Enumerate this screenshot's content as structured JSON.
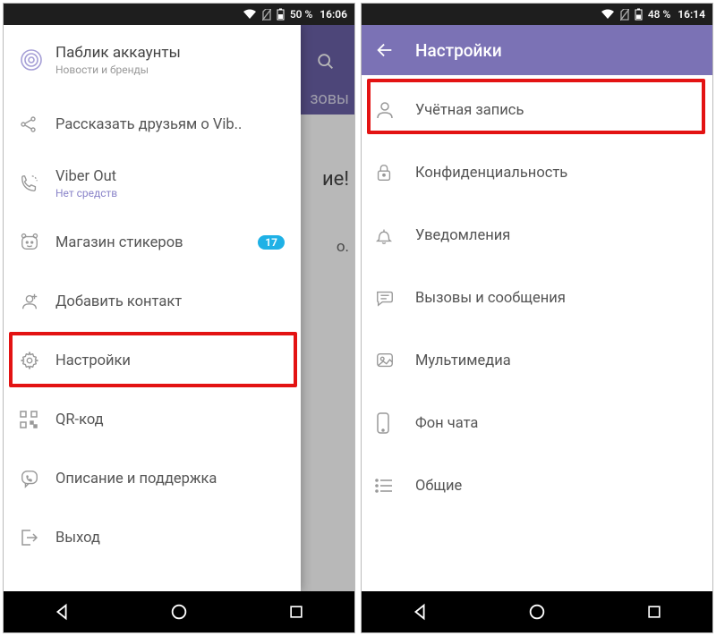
{
  "left": {
    "status": {
      "battery_pct": "50 %",
      "time": "16:06"
    },
    "bg": {
      "tabtail": "зовы",
      "linetail": "ие!",
      "dot": "о."
    },
    "drawer": {
      "header": {
        "title": "Паблик аккаунты",
        "subtitle": "Новости и бренды"
      },
      "items": [
        {
          "id": "share",
          "label": "Рассказать друзьям о Vib.."
        },
        {
          "id": "viberout",
          "label": "Viber Out",
          "sub": "Нет средств"
        },
        {
          "id": "stickers",
          "label": "Магазин стикеров",
          "badge": "17"
        },
        {
          "id": "addcontact",
          "label": "Добавить контакт"
        },
        {
          "id": "settings",
          "label": "Настройки"
        },
        {
          "id": "qr",
          "label": "QR-код"
        },
        {
          "id": "help",
          "label": "Описание и поддержка"
        },
        {
          "id": "exit",
          "label": "Выход"
        }
      ]
    }
  },
  "right": {
    "status": {
      "battery_pct": "48 %",
      "time": "16:14"
    },
    "appbar_title": "Настройки",
    "items": [
      {
        "id": "account",
        "label": "Учётная запись"
      },
      {
        "id": "privacy",
        "label": "Конфиденциальность"
      },
      {
        "id": "notif",
        "label": "Уведомления"
      },
      {
        "id": "calls",
        "label": "Вызовы и сообщения"
      },
      {
        "id": "media",
        "label": "Мультимедиа"
      },
      {
        "id": "chatbg",
        "label": "Фон чата"
      },
      {
        "id": "general",
        "label": "Общие"
      }
    ]
  }
}
